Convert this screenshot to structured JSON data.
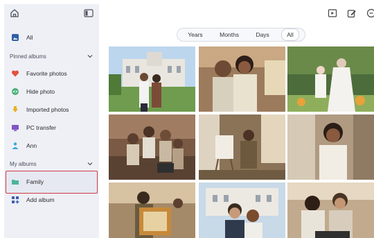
{
  "sidebar": {
    "all_label": "All",
    "pinned_section": "Pinned albums",
    "pinned": [
      {
        "label": "Favorite photos",
        "icon": "heart-icon",
        "color": "#e4513e"
      },
      {
        "label": "Hide photo",
        "icon": "hide-icon",
        "color": "#4cb27a"
      },
      {
        "label": "Imported photos",
        "icon": "import-icon",
        "color": "#e8b321"
      },
      {
        "label": "PC transfer",
        "icon": "pc-icon",
        "color": "#8155c4"
      },
      {
        "label": "Ann",
        "icon": "person-icon",
        "color": "#3aa8d8"
      }
    ],
    "albums_section": "My albums",
    "albums": [
      {
        "label": "Family",
        "icon": "folder-icon",
        "color": "#4bb59a",
        "selected": true
      },
      {
        "label": "Add album",
        "icon": "add-album-icon",
        "color": "#3f5fb0"
      }
    ]
  },
  "filters": {
    "items": [
      "Years",
      "Months",
      "Days",
      "All"
    ],
    "active": "All"
  },
  "colors": {
    "sidebar_bg": "#eef0f6",
    "selection_border": "#d23a45"
  }
}
